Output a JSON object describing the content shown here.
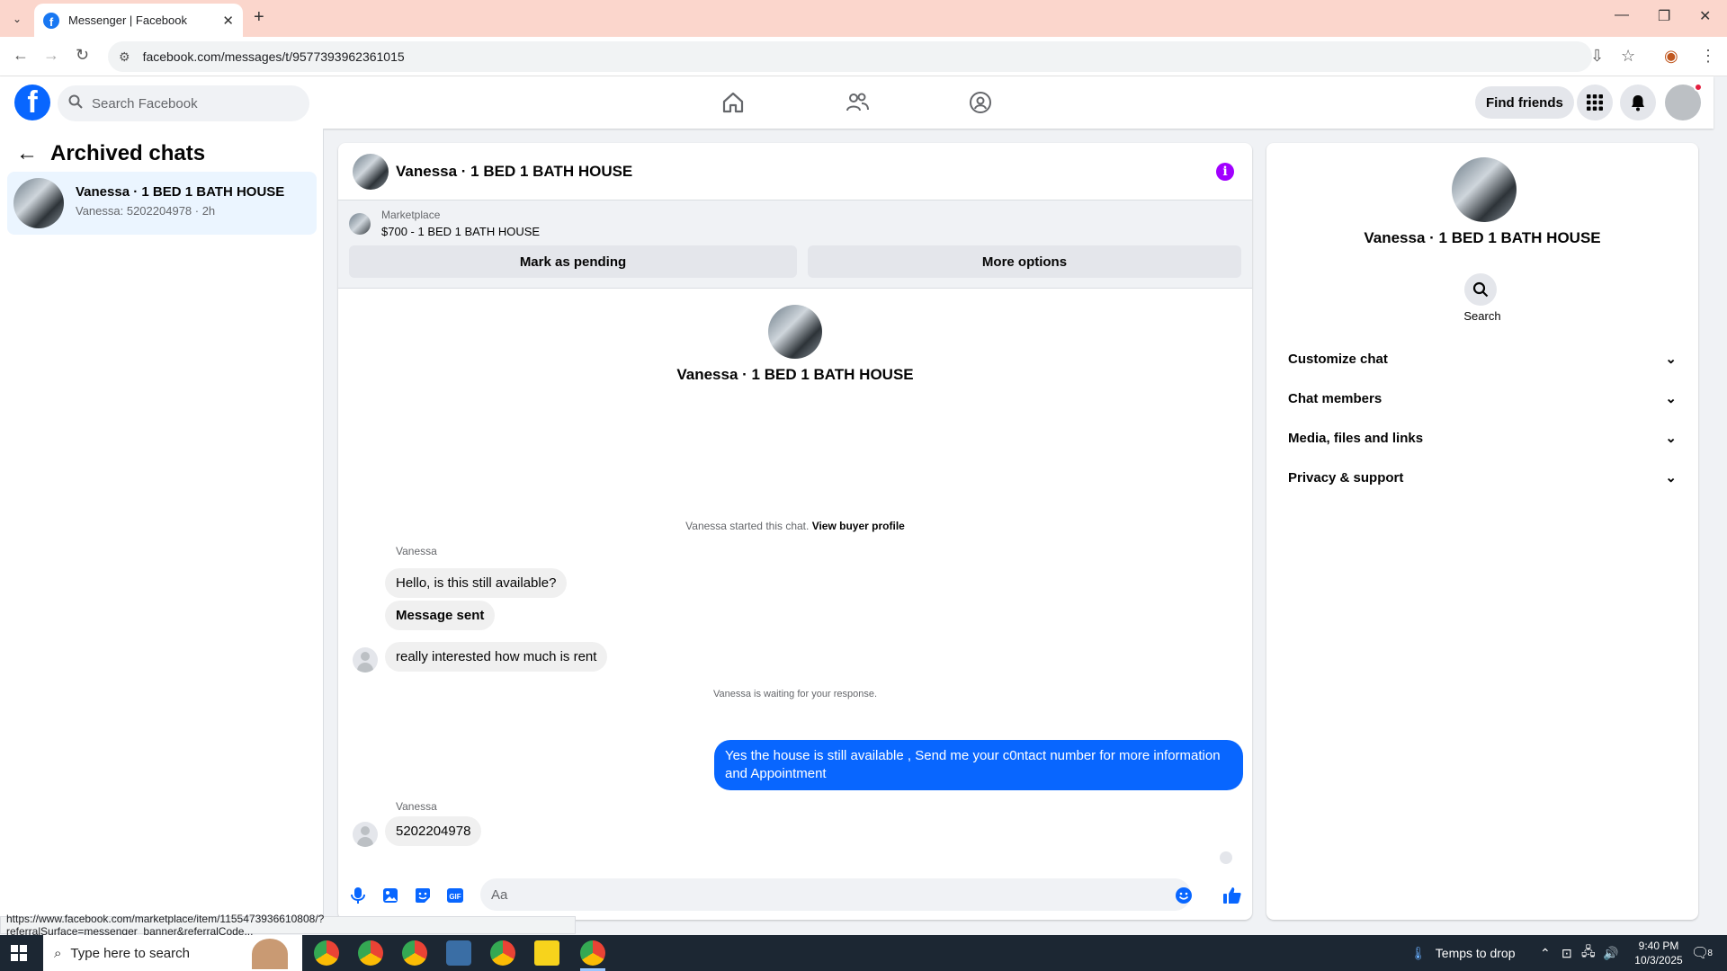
{
  "browser": {
    "tab_title": "Messenger | Facebook",
    "url": "facebook.com/messages/t/9577393962361015"
  },
  "fb_header": {
    "search_placeholder": "Search Facebook",
    "find_friends": "Find friends"
  },
  "sidebar": {
    "title": "Archived chats",
    "chats": [
      {
        "name": "Vanessa · 1 BED 1 BATH HOUSE",
        "preview": "Vanessa: 5202204978 · 2h"
      }
    ]
  },
  "conversation": {
    "title": "Vanessa · 1 BED 1 BATH HOUSE",
    "marketplace_label": "Marketplace",
    "listing": "$700 - 1 BED 1 BATH HOUSE",
    "mark_pending": "Mark as pending",
    "more_options": "More options",
    "profile_name": "Vanessa · 1 BED 1 BATH HOUSE",
    "started_text": "Vanessa started this chat.",
    "view_buyer_profile": "View buyer profile",
    "sender_1": "Vanessa",
    "msg_1": "Hello, is this still available?",
    "msg_2": "Message sent",
    "msg_3": "really interested how much is rent",
    "waiting_text": "Vanessa is waiting for your response.",
    "msg_out": "Yes the house is still available , Send me your c0ntact number for more information and Appointment",
    "sender_2": "Vanessa",
    "msg_4": "5202204978",
    "composer_placeholder": "Aa"
  },
  "right_panel": {
    "name": "Vanessa · 1 BED 1 BATH HOUSE",
    "search_label": "Search",
    "sections": [
      "Customize chat",
      "Chat members",
      "Media, files and links",
      "Privacy & support"
    ]
  },
  "status_url": "https://www.facebook.com/marketplace/item/1155473936610808/?referralSurface=messenger_banner&referralCode...",
  "taskbar": {
    "search_placeholder": "Type here to search",
    "weather": "Temps to drop",
    "time": "9:40 PM",
    "date": "10/3/2025",
    "notification_count": "8"
  },
  "colors": {
    "fb_blue": "#0866ff",
    "tab_bar": "#fbd6cc",
    "info_purple": "#a100ff"
  }
}
